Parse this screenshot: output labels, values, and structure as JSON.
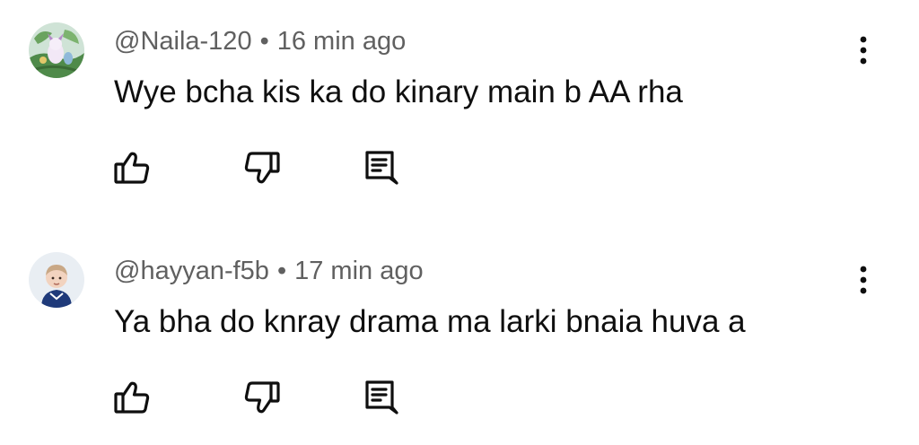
{
  "comments": [
    {
      "handle": "@Naila-120",
      "separator": "•",
      "time": "16 min ago",
      "text": "Wye bcha kis ka do kinary main b AA rha",
      "avatar": "illustrated-avatar",
      "actions": [
        "like-icon",
        "dislike-icon",
        "reply-icon"
      ],
      "menu_icon": "more-vert-icon"
    },
    {
      "handle": "@hayyan-f5b",
      "separator": "•",
      "time": "17 min ago",
      "text": "Ya bha do knray drama ma larki bnaia huva a",
      "avatar": "baby-photo-avatar",
      "actions": [
        "like-icon",
        "dislike-icon",
        "reply-icon"
      ],
      "menu_icon": "more-vert-icon"
    }
  ],
  "colors": {
    "text_primary": "#0f0f0f",
    "text_secondary": "#606060",
    "icon": "#0f0f0f",
    "background": "#ffffff"
  }
}
